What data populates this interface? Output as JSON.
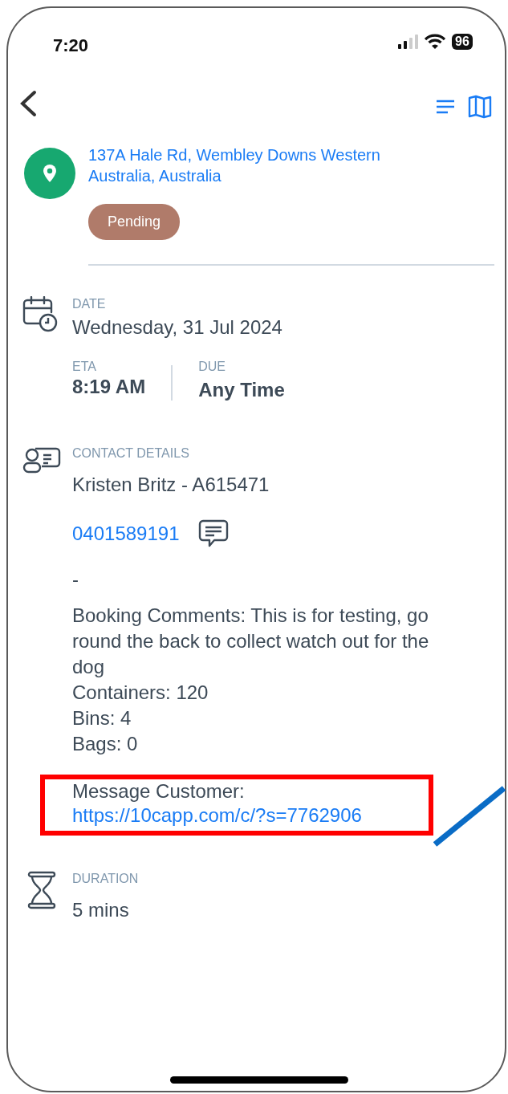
{
  "status_bar": {
    "time": "7:20",
    "battery": "96"
  },
  "location": {
    "address": "137A Hale Rd, Wembley Downs Western Australia, Australia",
    "status": "Pending"
  },
  "date": {
    "label": "DATE",
    "value": "Wednesday, 31 Jul 2024",
    "eta_label": "ETA",
    "eta": "8:19 AM",
    "due_label": "DUE",
    "due": "Any Time"
  },
  "contact": {
    "label": "CONTACT DETAILS",
    "name": "Kristen Britz - A615471",
    "phone": "0401589191",
    "email": "-",
    "notes": [
      "Booking Comments: This is for testing, go round the back to collect watch out for the dog",
      "Containers: 120",
      "Bins: 4",
      "Bags: 0"
    ],
    "message_label": "Message Customer:",
    "message_link": "https://10capp.com/c/?s=7762906",
    "highlighted": true
  },
  "duration": {
    "label": "DURATION",
    "value": "5 mins"
  }
}
